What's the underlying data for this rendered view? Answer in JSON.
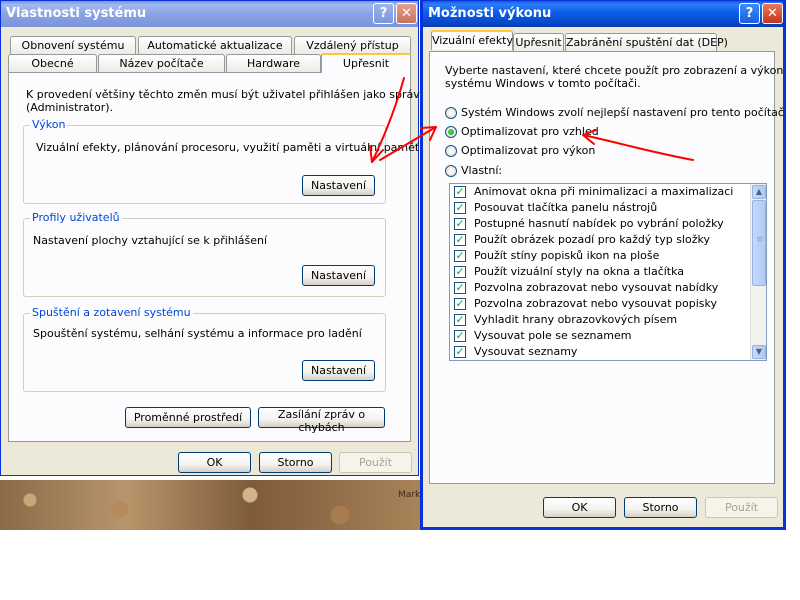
{
  "colors": {
    "arrow": "#ff0000",
    "group_label": "#0046d5",
    "title_active": "#0a5ae0"
  },
  "wallpaper": {
    "text": "Mark"
  },
  "sys_window": {
    "title": "Vlastnosti systému",
    "help_glyph": "?",
    "close_glyph": "✕",
    "tabs_row1": [
      "Obnovení systému",
      "Automatické aktualizace",
      "Vzdálený přístup"
    ],
    "tabs_row2": [
      "Obecné",
      "Název počítače",
      "Hardware",
      "Upřesnit"
    ],
    "active_tab": "Upřesnit",
    "admin_note_line1": "K provedení většiny těchto změn musí být uživatel přihlášen jako správce",
    "admin_note_line2": "(Administrator).",
    "groups": {
      "performance": {
        "label": "Výkon",
        "text": "Vizuální efekty, plánování procesoru, využití paměti a virtuální paměť",
        "button": "Nastavení"
      },
      "profiles": {
        "label": "Profily uživatelů",
        "text": "Nastavení plochy vztahující se k přihlášení",
        "button": "Nastavení"
      },
      "startup": {
        "label": "Spuštění a zotavení systému",
        "text": "Spouštění systému, selhání systému a informace pro ladění",
        "button": "Nastavení"
      }
    },
    "env_button": "Proměnné prostředí",
    "error_button": "Zasílání zpráv o chybách",
    "ok": "OK",
    "cancel": "Storno",
    "apply": "Použít"
  },
  "perf_window": {
    "title": "Možnosti výkonu",
    "help_glyph": "?",
    "close_glyph": "✕",
    "tabs": [
      "Vizuální efekty",
      "Upřesnit",
      "Zabránění spuštění dat (DEP)"
    ],
    "active_tab": "Vizuální efekty",
    "intro_line1": "Vyberte nastavení, které chcete použít pro zobrazení a výkon",
    "intro_line2": "systému Windows v tomto počítači.",
    "radios": [
      {
        "label": "Systém Windows zvolí nejlepší nastavení pro tento počítač",
        "checked": false
      },
      {
        "label": "Optimalizovat pro vzhled",
        "checked": true
      },
      {
        "label": "Optimalizovat pro výkon",
        "checked": false
      },
      {
        "label": "Vlastní:",
        "checked": false
      }
    ],
    "checkbox_items": [
      "Animovat okna při minimalizaci a maximalizaci",
      "Posouvat tlačítka panelu nástrojů",
      "Postupné hasnutí nabídek po vybrání položky",
      "Použít obrázek pozadí pro každý typ složky",
      "Použít stíny popisků ikon na ploše",
      "Použít vizuální styly na okna a tlačítka",
      "Pozvolna zobrazovat nebo vysouvat nabídky",
      "Pozvolna zobrazovat nebo vysouvat popisky",
      "Vyhladit hrany obrazovkových písem",
      "Vysouvat pole se seznamem",
      "Vysouvat seznamy"
    ],
    "check_glyph": "✓",
    "scroll_up_glyph": "▲",
    "scroll_down_glyph": "▼",
    "ok": "OK",
    "cancel": "Storno",
    "apply": "Použít"
  }
}
